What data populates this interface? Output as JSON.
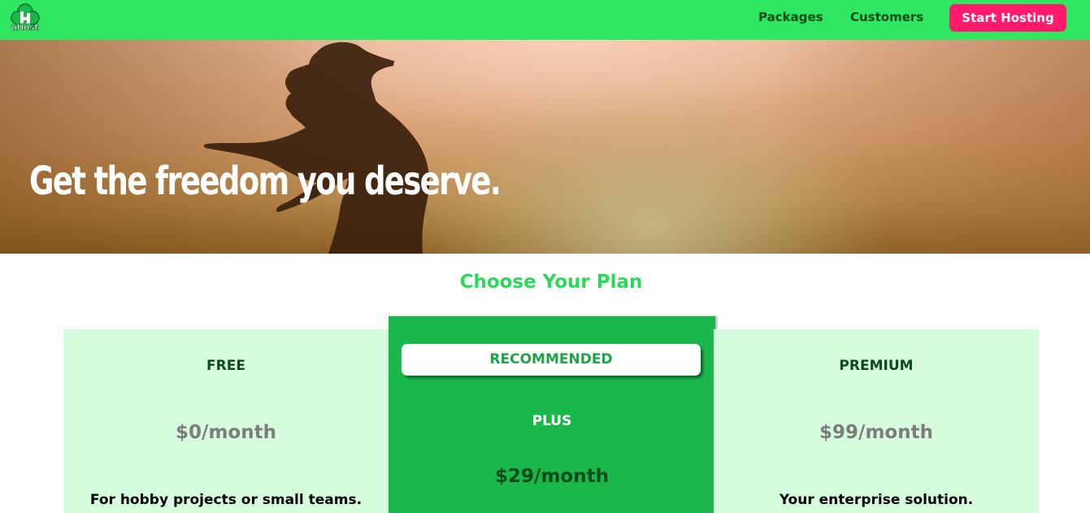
{
  "header": {
    "logo_text": "uHost",
    "nav": [
      {
        "label": "Packages"
      },
      {
        "label": "Customers"
      }
    ],
    "cta_label": "Start Hosting"
  },
  "hero": {
    "title": "Get the freedom you deserve."
  },
  "plans": {
    "title": "Choose Your Plan",
    "items": [
      {
        "name": "FREE",
        "price": "$0/month",
        "description": "For hobby projects or small teams."
      },
      {
        "badge": "RECOMMENDED",
        "name": "PLUS",
        "price": "$29/month"
      },
      {
        "name": "PREMIUM",
        "price": "$99/month",
        "description": "Your enterprise solution."
      }
    ]
  },
  "colors": {
    "header_bg": "#2ee65f",
    "cta_bg": "#ff1a6c",
    "accent_green": "#2ed65a",
    "plan_bg": "#d5fcdc",
    "recommended_bg": "#1ab84a"
  }
}
